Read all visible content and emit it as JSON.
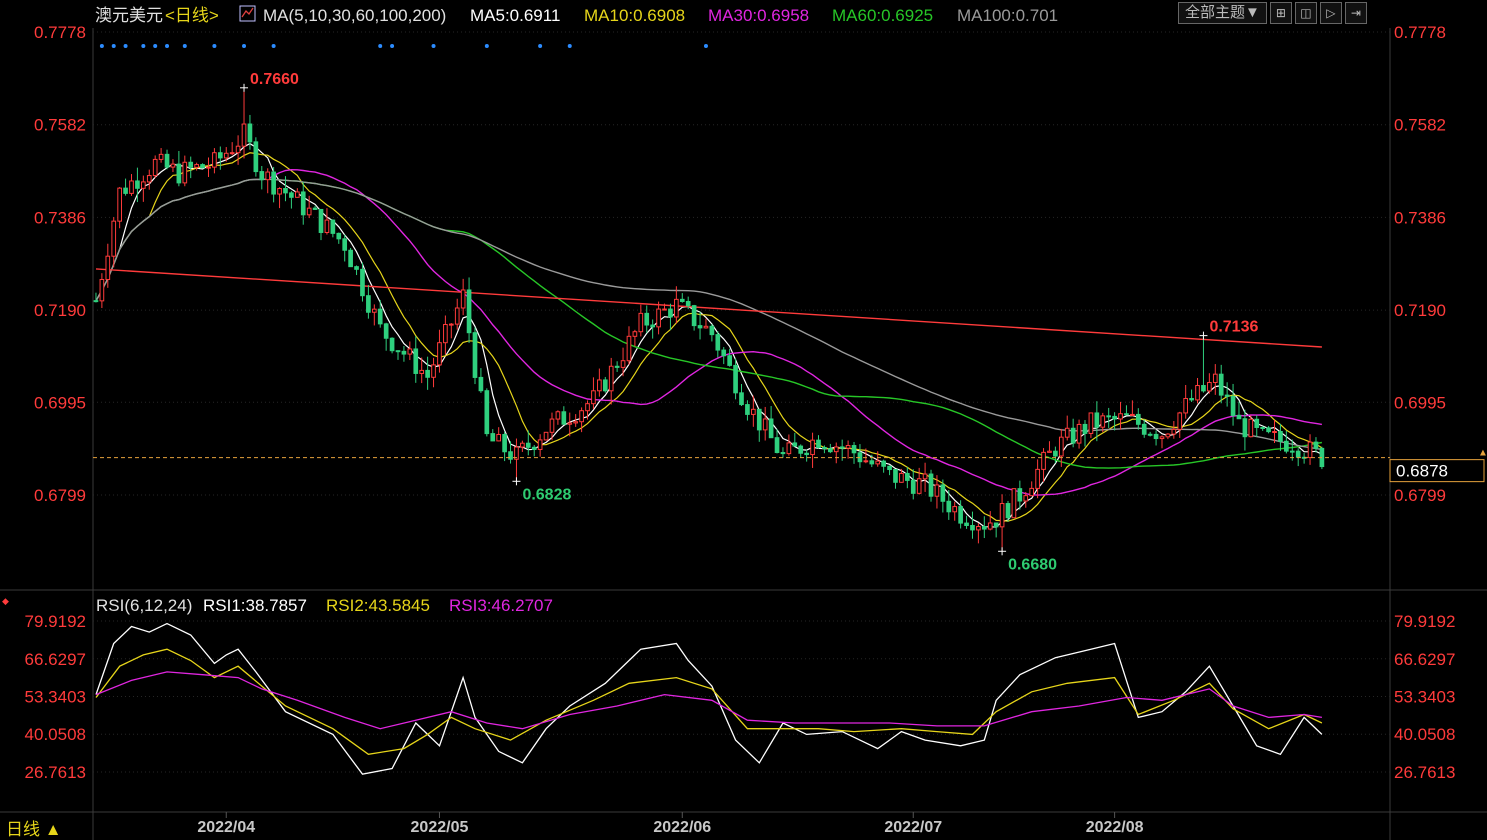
{
  "instrument": {
    "name": "澳元美元",
    "period": "<日线>",
    "ma_label": "MA(5,10,30,60,100,200)",
    "ma_values": [
      {
        "label": "MA5:0.6911",
        "color": "#ffffff"
      },
      {
        "label": "MA10:0.6908",
        "color": "#e6d51a"
      },
      {
        "label": "MA30:0.6958",
        "color": "#e026e0"
      },
      {
        "label": "MA60:0.6925",
        "color": "#27c627"
      },
      {
        "label": "MA100:0.701",
        "color": "#9a9a9a"
      }
    ]
  },
  "toolbar": {
    "theme_label": "全部主题▼",
    "buttons": [
      {
        "name": "layout-grid-icon",
        "glyph": "⊞"
      },
      {
        "name": "layout-columns-icon",
        "glyph": "◫"
      },
      {
        "name": "play-icon",
        "glyph": "▷"
      },
      {
        "name": "arrow-right-icon",
        "glyph": "⇥"
      }
    ]
  },
  "price_axis": {
    "ticks": [
      "0.7778",
      "0.7582",
      "0.7386",
      "0.7190",
      "0.6995",
      "0.6799"
    ]
  },
  "last_price": "0.6878",
  "annotations": [
    {
      "text": "0.7660",
      "value": 0.766,
      "index": 25,
      "color": "#ff3b3b"
    },
    {
      "text": "0.6828",
      "value": 0.6828,
      "index": 71,
      "color": "#2ecc71"
    },
    {
      "text": "0.6680",
      "value": 0.668,
      "index": 153,
      "color": "#2ecc71"
    },
    {
      "text": "0.7136",
      "value": 0.7136,
      "index": 187,
      "color": "#ff3b3b"
    }
  ],
  "rsi": {
    "label": "RSI(6,12,24)",
    "values": [
      {
        "label": "RSI1:38.7857",
        "color": "#ffffff"
      },
      {
        "label": "RSI2:43.5845",
        "color": "#e6d51a"
      },
      {
        "label": "RSI3:46.2707",
        "color": "#e026e0"
      }
    ],
    "ticks": [
      "79.9192",
      "66.6297",
      "53.3403",
      "40.0508",
      "26.7613"
    ]
  },
  "x_axis": {
    "labels": [
      "2022/04",
      "2022/05",
      "2022/06",
      "2022/07",
      "2022/08"
    ]
  },
  "period_selector": "日线 ▲",
  "colors": {
    "up": "#ff3b3b",
    "down": "#2fd07e",
    "axis_text": "#ff3b3b",
    "ma200": "#ff3b3b",
    "grid": "#262626"
  },
  "chart_data": {
    "type": "candlestick",
    "title": "澳元美元 <日线>",
    "ylim": [
      0.662,
      0.78
    ],
    "x_labels": [
      "2022/04",
      "2022/05",
      "2022/06",
      "2022/07",
      "2022/08"
    ],
    "x_label_index": [
      22,
      58,
      99,
      138,
      172
    ],
    "candles_count": 219,
    "key_points": [
      {
        "label": "high",
        "value": 0.766,
        "index": 25
      },
      {
        "label": "low",
        "value": 0.6828,
        "index": 71
      },
      {
        "label": "low",
        "value": 0.668,
        "index": 153
      },
      {
        "label": "high",
        "value": 0.7136,
        "index": 187
      }
    ],
    "price_path": [
      [
        0,
        0.721
      ],
      [
        4,
        0.744
      ],
      [
        10,
        0.75
      ],
      [
        14,
        0.748
      ],
      [
        20,
        0.75
      ],
      [
        25,
        0.756
      ],
      [
        28,
        0.748
      ],
      [
        34,
        0.742
      ],
      [
        42,
        0.733
      ],
      [
        48,
        0.715
      ],
      [
        56,
        0.705
      ],
      [
        62,
        0.722
      ],
      [
        66,
        0.692
      ],
      [
        71,
        0.688
      ],
      [
        76,
        0.694
      ],
      [
        84,
        0.7
      ],
      [
        92,
        0.716
      ],
      [
        98,
        0.72
      ],
      [
        104,
        0.714
      ],
      [
        110,
        0.699
      ],
      [
        116,
        0.688
      ],
      [
        122,
        0.692
      ],
      [
        128,
        0.689
      ],
      [
        134,
        0.684
      ],
      [
        140,
        0.682
      ],
      [
        146,
        0.676
      ],
      [
        150,
        0.674
      ],
      [
        152,
        0.675
      ],
      [
        156,
        0.68
      ],
      [
        162,
        0.69
      ],
      [
        168,
        0.695
      ],
      [
        174,
        0.696
      ],
      [
        180,
        0.693
      ],
      [
        185,
        0.7
      ],
      [
        189,
        0.704
      ],
      [
        193,
        0.695
      ],
      [
        197,
        0.692
      ],
      [
        202,
        0.691
      ],
      [
        207,
        0.6878
      ]
    ],
    "ma_series": [
      {
        "name": "MA5",
        "color": "#ffffff",
        "width": 1.2
      },
      {
        "name": "MA10",
        "color": "#e6d51a",
        "width": 1.2
      },
      {
        "name": "MA30",
        "color": "#e026e0",
        "width": 1.4
      },
      {
        "name": "MA60",
        "color": "#27c627",
        "width": 1.4
      },
      {
        "name": "MA100",
        "color": "#9a9a9a",
        "width": 1.4
      },
      {
        "name": "MA200",
        "color": "#ff3b3b",
        "width": 1.4,
        "points": [
          [
            0,
            0.7277
          ],
          [
            207,
            0.7112
          ]
        ]
      }
    ],
    "rsi_ylim": [
      20,
      88
    ],
    "rsi_series": [
      {
        "name": "RSI1",
        "color": "#ffffff",
        "points": [
          [
            0,
            54
          ],
          [
            3,
            72
          ],
          [
            6,
            78
          ],
          [
            9,
            76
          ],
          [
            12,
            79
          ],
          [
            16,
            75
          ],
          [
            20,
            65
          ],
          [
            22,
            68
          ],
          [
            24,
            70
          ],
          [
            27,
            62
          ],
          [
            32,
            48
          ],
          [
            40,
            40
          ],
          [
            45,
            26
          ],
          [
            50,
            28
          ],
          [
            54,
            44
          ],
          [
            58,
            36
          ],
          [
            62,
            60
          ],
          [
            64,
            46
          ],
          [
            68,
            34
          ],
          [
            72,
            30
          ],
          [
            76,
            42
          ],
          [
            80,
            50
          ],
          [
            86,
            58
          ],
          [
            92,
            70
          ],
          [
            98,
            72
          ],
          [
            100,
            66
          ],
          [
            104,
            57
          ],
          [
            108,
            38
          ],
          [
            112,
            30
          ],
          [
            116,
            44
          ],
          [
            120,
            40
          ],
          [
            126,
            41
          ],
          [
            132,
            35
          ],
          [
            136,
            41
          ],
          [
            140,
            38
          ],
          [
            146,
            36
          ],
          [
            150,
            38
          ],
          [
            152,
            52
          ],
          [
            156,
            61
          ],
          [
            162,
            67
          ],
          [
            168,
            70
          ],
          [
            172,
            72
          ],
          [
            176,
            46
          ],
          [
            180,
            48
          ],
          [
            184,
            55
          ],
          [
            188,
            64
          ],
          [
            192,
            50
          ],
          [
            196,
            36
          ],
          [
            200,
            33
          ],
          [
            204,
            46
          ],
          [
            207,
            40
          ]
        ]
      },
      {
        "name": "RSI2",
        "color": "#e6d51a",
        "points": [
          [
            0,
            53
          ],
          [
            4,
            64
          ],
          [
            8,
            68
          ],
          [
            12,
            70
          ],
          [
            16,
            66
          ],
          [
            20,
            60
          ],
          [
            24,
            64
          ],
          [
            28,
            57
          ],
          [
            32,
            50
          ],
          [
            40,
            42
          ],
          [
            46,
            33
          ],
          [
            52,
            35
          ],
          [
            56,
            40
          ],
          [
            60,
            46
          ],
          [
            64,
            42
          ],
          [
            70,
            38
          ],
          [
            76,
            45
          ],
          [
            84,
            52
          ],
          [
            90,
            58
          ],
          [
            98,
            60
          ],
          [
            104,
            56
          ],
          [
            110,
            42
          ],
          [
            116,
            42
          ],
          [
            122,
            42
          ],
          [
            128,
            41
          ],
          [
            136,
            42
          ],
          [
            142,
            41
          ],
          [
            148,
            40
          ],
          [
            152,
            48
          ],
          [
            158,
            55
          ],
          [
            164,
            58
          ],
          [
            172,
            60
          ],
          [
            176,
            47
          ],
          [
            182,
            52
          ],
          [
            188,
            58
          ],
          [
            192,
            49
          ],
          [
            198,
            42
          ],
          [
            204,
            47
          ],
          [
            207,
            44
          ]
        ]
      },
      {
        "name": "RSI3",
        "color": "#e026e0",
        "points": [
          [
            0,
            54
          ],
          [
            6,
            59
          ],
          [
            12,
            62
          ],
          [
            18,
            61
          ],
          [
            24,
            60
          ],
          [
            28,
            56
          ],
          [
            34,
            52
          ],
          [
            42,
            46
          ],
          [
            48,
            42
          ],
          [
            54,
            45
          ],
          [
            60,
            48
          ],
          [
            66,
            44
          ],
          [
            72,
            42
          ],
          [
            80,
            47
          ],
          [
            88,
            50
          ],
          [
            96,
            54
          ],
          [
            104,
            52
          ],
          [
            110,
            45
          ],
          [
            118,
            44
          ],
          [
            126,
            44
          ],
          [
            134,
            44
          ],
          [
            142,
            43
          ],
          [
            150,
            43
          ],
          [
            158,
            48
          ],
          [
            166,
            50
          ],
          [
            174,
            53
          ],
          [
            180,
            52
          ],
          [
            188,
            56
          ],
          [
            192,
            50
          ],
          [
            198,
            46
          ],
          [
            204,
            47
          ],
          [
            207,
            46
          ]
        ]
      }
    ]
  }
}
